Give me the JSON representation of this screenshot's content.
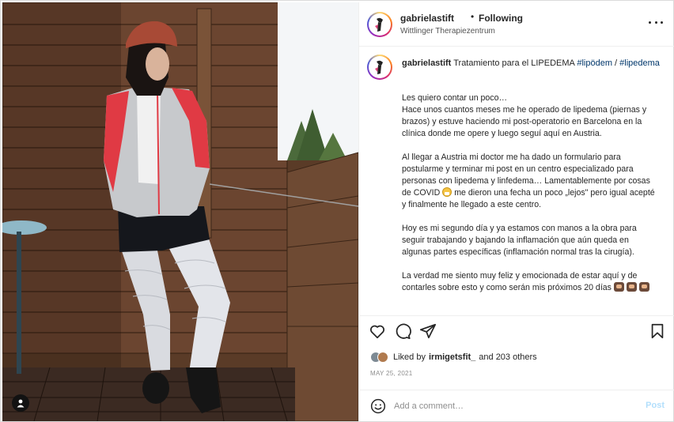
{
  "header": {
    "username": "gabrielastift",
    "separator": "•",
    "follow_status": "Following",
    "location": "Wittlinger Therapiezentrum"
  },
  "caption": {
    "username": "gabrielastift",
    "title": "Tratamiento para el LIPEDEMA",
    "tag1": "#lipödem",
    "slash": "/",
    "tag2": "#lipedema",
    "p1_line1": "Les quiero contar un poco…",
    "p1_rest": "Hace unos cuantos meses me he operado de lipedema (piernas y brazos) y estuve haciendo mi post-operatorio en Barcelona en la clínica donde me opere y luego seguí aquí en Austria.",
    "p2_before": "Al llegar a Austria mi doctor me ha dado un formulario para postularme y terminar mi post en un centro especializado para personas con lipedema y linfedema… Lamentablemente por cosas de COVID",
    "p2_after": "me dieron una fecha un poco „lejos\" pero igual acepté y finalmente he llegado a este centro.",
    "p3": "Hoy es mi segundo día y ya estamos con manos a la obra para seguir trabajando y bajando la inflamación que aún queda en algunas partes específicas (inflamación normal tras la cirugía).",
    "p4": "La verdad me siento muy feliz y emocionada de estar aquí y de contarles sobre esto y como serán mis próximos 20 días"
  },
  "icons": {
    "more": "more-options-icon",
    "like": "heart-icon",
    "comment": "comment-icon",
    "share": "paper-plane-icon",
    "save": "bookmark-icon",
    "emoji": "smiley-icon",
    "user_tag": "person-icon"
  },
  "likes": {
    "prefix": "Liked by",
    "user": "irmigetsfit_",
    "suffix": "and 203 others"
  },
  "date": "MAY 25, 2021",
  "comment": {
    "placeholder": "Add a comment…",
    "post_label": "Post"
  },
  "colors": {
    "link": "#00376b",
    "post_disabled": "#b2dffc",
    "muted": "#8e8e8e"
  }
}
